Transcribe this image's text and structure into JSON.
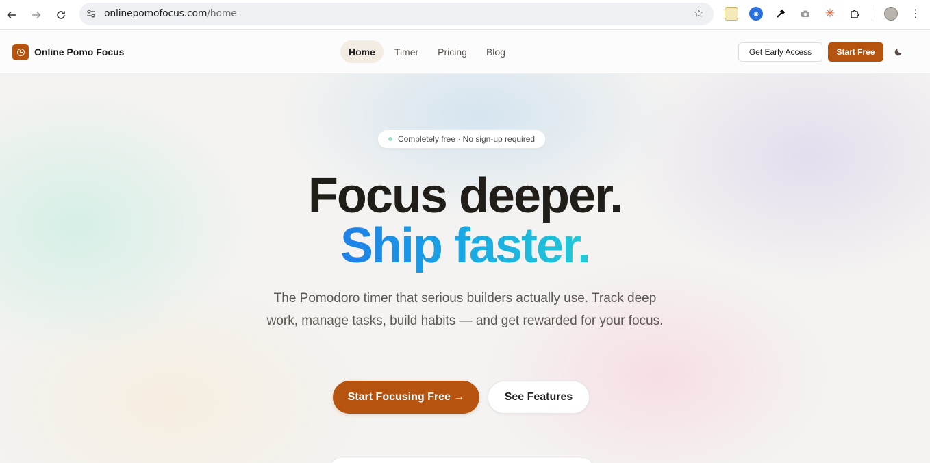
{
  "browser": {
    "url_domain": "onlinepomofocus.com",
    "url_path": "/home",
    "back_icon": "back-arrow-icon",
    "forward_icon": "forward-arrow-icon",
    "reload_icon": "reload-icon"
  },
  "header": {
    "brand": "Online Pomo Focus",
    "nav": [
      "Home",
      "Timer",
      "Pricing",
      "Blog"
    ],
    "active_nav": "Home",
    "early_access": "Get Early Access",
    "start_free": "Start Free"
  },
  "hero": {
    "badge": "Completely free · No sign-up required",
    "headline_1": "Focus deeper.",
    "headline_2": "Ship faster.",
    "lede": "The Pomodoro timer that serious builders actually use. Track deep work, manage tasks, build habits — and get rewarded for your focus.",
    "cta_primary": "Start Focusing Free →",
    "cta_secondary": "See Features"
  },
  "colors": {
    "brand": "#b5530f",
    "headline": "#211d18",
    "gradient_start": "#1f7fe6",
    "gradient_end": "#21cbd6"
  }
}
